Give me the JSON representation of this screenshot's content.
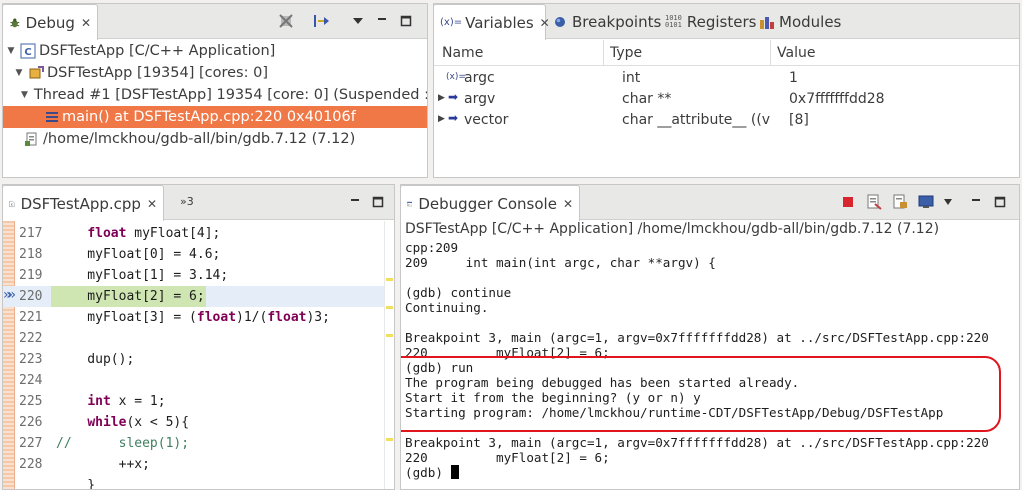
{
  "debug_view": {
    "tab_label": "Debug",
    "tree": [
      "DSFTestApp [C/C++ Application]",
      "DSFTestApp [19354] [cores: 0]",
      "Thread #1 [DSFTestApp] 19354 [core: 0] (Suspended : Br",
      "main() at DSFTestApp.cpp:220 0x40106f",
      "/home/lmckhou/gdb-all/bin/gdb.7.12 (7.12)"
    ]
  },
  "variables_view": {
    "tabs": [
      "Variables",
      "Breakpoints",
      "Registers",
      "Modules"
    ],
    "columns": [
      "Name",
      "Type",
      "Value"
    ],
    "rows": [
      {
        "name": "argc",
        "type": "int",
        "value": "1"
      },
      {
        "name": "argv",
        "type": "char **",
        "value": "0x7fffffffdd28"
      },
      {
        "name": "vector",
        "type": "char __attribute__ ((ve",
        "value": "[8]"
      }
    ]
  },
  "editor": {
    "tab_label": "DSFTestApp.cpp",
    "overflow_label": "»3",
    "current_line": "220",
    "lines": [
      {
        "num": "217",
        "text": "    float myFloat[4];"
      },
      {
        "num": "218",
        "text": "    myFloat[0] = 4.6;"
      },
      {
        "num": "219",
        "text": "    myFloat[1] = 3.14;"
      },
      {
        "num": "220",
        "text": "    myFloat[2] = 6;"
      },
      {
        "num": "221",
        "text": "    myFloat[3] = (float)1/(float)3;"
      },
      {
        "num": "222",
        "text": ""
      },
      {
        "num": "223",
        "text": "    dup();"
      },
      {
        "num": "224",
        "text": ""
      },
      {
        "num": "225",
        "text": "    int x = 1;"
      },
      {
        "num": "226",
        "text": "    while(x < 5){"
      },
      {
        "num": "227",
        "text": "//      sleep(1);"
      },
      {
        "num": "228",
        "text": "        ++x;"
      },
      {
        "num": "",
        "text": "    }"
      }
    ]
  },
  "console": {
    "tab_label": "Debugger Console",
    "header": "DSFTestApp [C/C++ Application] /home/lmckhou/gdb-all/bin/gdb.7.12 (7.12)",
    "lines": [
      "cpp:209",
      "209     int main(int argc, char **argv) {",
      "",
      "(gdb) continue",
      "Continuing.",
      "",
      "Breakpoint 3, main (argc=1, argv=0x7fffffffdd28) at ../src/DSFTestApp.cpp:220",
      "220         myFloat[2] = 6;",
      "(gdb) run",
      "The program being debugged has been started already.",
      "Start it from the beginning? (y or n) y",
      "Starting program: /home/lmckhou/runtime-CDT/DSFTestApp/Debug/DSFTestApp",
      "",
      "Breakpoint 3, main (argc=1, argv=0x7fffffffdd28) at ../src/DSFTestApp.cpp:220",
      "220         myFloat[2] = 6;",
      "(gdb) "
    ],
    "highlight_color": "#e0151e"
  }
}
